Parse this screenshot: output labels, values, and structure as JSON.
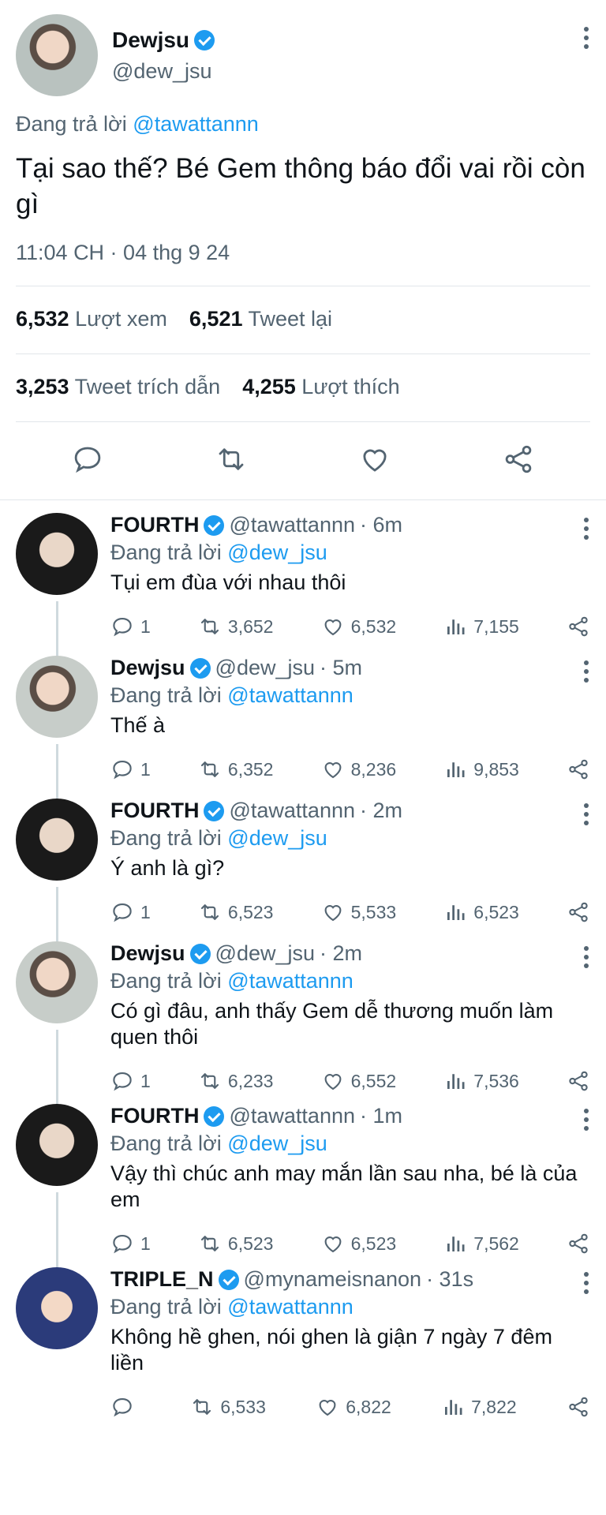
{
  "main_tweet": {
    "name": "Dewjsu",
    "handle": "@dew_jsu",
    "reply_prefix": "Đang trả lời",
    "reply_to": "@tawattannn",
    "text": "Tại sao thế? Bé Gem thông báo đổi vai rồi còn gì",
    "timestamp": "11:04 CH · 04 thg 9 24",
    "views_count": "6,532",
    "views_label": "Lượt xem",
    "retweets_count": "6,521",
    "retweets_label": "Tweet lại",
    "quotes_count": "3,253",
    "quotes_label": "Tweet trích dẫn",
    "likes_count": "4,255",
    "likes_label": "Lượt thích"
  },
  "replies": [
    {
      "name": "FOURTH",
      "handle": "@tawattannn",
      "time": "· 6m",
      "reply_prefix": "Đang trả lời",
      "reply_to": "@dew_jsu",
      "text": "Tụi em đùa với nhau thôi",
      "replies": "1",
      "retweets": "3,652",
      "likes": "6,532",
      "views": "7,155"
    },
    {
      "name": "Dewjsu",
      "handle": "@dew_jsu",
      "time": "· 5m",
      "reply_prefix": "Đang trả lời",
      "reply_to": "@tawattannn",
      "text": "Thế à",
      "replies": "1",
      "retweets": "6,352",
      "likes": "8,236",
      "views": "9,853"
    },
    {
      "name": "FOURTH",
      "handle": "@tawattannn",
      "time": "· 2m",
      "reply_prefix": "Đang trả lời",
      "reply_to": "@dew_jsu",
      "text": "Ý anh là gì?",
      "replies": "1",
      "retweets": "6,523",
      "likes": "5,533",
      "views": "6,523"
    },
    {
      "name": "Dewjsu",
      "handle": "@dew_jsu",
      "time": "· 2m",
      "reply_prefix": "Đang trả lời",
      "reply_to": "@tawattannn",
      "text": "Có gì đâu, anh thấy Gem dễ thương muốn làm quen thôi",
      "replies": "1",
      "retweets": "6,233",
      "likes": "6,552",
      "views": "7,536"
    },
    {
      "name": "FOURTH",
      "handle": "@tawattannn",
      "time": "· 1m",
      "reply_prefix": "Đang trả lời",
      "reply_to": "@dew_jsu",
      "text": "Vậy thì chúc anh may mắn lần sau nha, bé là của em",
      "replies": "1",
      "retweets": "6,523",
      "likes": "6,523",
      "views": "7,562"
    },
    {
      "name": "TRIPLE_N",
      "handle": "@mynameisnanon",
      "time": "· 31s",
      "reply_prefix": "Đang trả lời",
      "reply_to": "@tawattannn",
      "text": "Không hề ghen, nói ghen là giận 7 ngày 7 đêm liền",
      "replies": "",
      "retweets": "6,533",
      "likes": "6,822",
      "views": "7,822"
    }
  ],
  "icons": {
    "reply": "reply-icon",
    "retweet": "retweet-icon",
    "like": "heart-icon",
    "views": "views-icon",
    "share": "share-icon",
    "verified": "verified-badge-icon",
    "more": "more-options-icon"
  },
  "colors": {
    "accent": "#1d9bf0",
    "text": "#0f1419",
    "muted": "#536471",
    "border": "#e1e6ea"
  }
}
